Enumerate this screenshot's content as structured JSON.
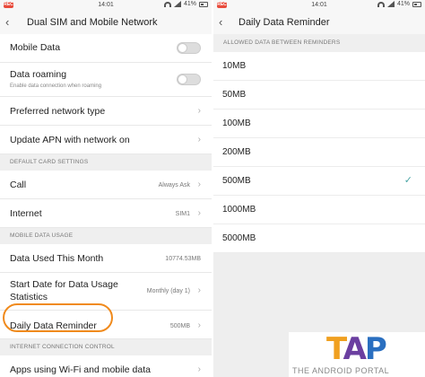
{
  "status": {
    "rec": "REC",
    "time": "14:01",
    "battery": "41%"
  },
  "left": {
    "title": "Dual SIM and Mobile Network",
    "rows": {
      "mobile_data": "Mobile Data",
      "data_roaming": "Data roaming",
      "data_roaming_sub": "Enable data connection when roaming",
      "preferred_network": "Preferred network type",
      "update_apn": "Update APN with network on",
      "call": "Call",
      "call_value": "Always Ask",
      "internet": "Internet",
      "internet_value": "SIM1",
      "data_used": "Data Used This Month",
      "data_used_value": "10774.53MB",
      "start_date_l1": "Start Date for Data Usage",
      "start_date_l2": "Statistics",
      "start_date_value": "Monthly (day 1)",
      "reminder": "Daily Data Reminder",
      "reminder_value": "500MB",
      "apps_wifi": "Apps using Wi-Fi and mobile data"
    },
    "sections": {
      "default_card": "DEFAULT CARD SETTINGS",
      "mobile_usage": "MOBILE DATA USAGE",
      "internet_control": "INTERNET CONNECTION CONTROL"
    }
  },
  "right": {
    "title": "Daily Data Reminder",
    "section": "ALLOWED DATA BETWEEN REMINDERS",
    "options": [
      "10MB",
      "50MB",
      "100MB",
      "200MB",
      "500MB",
      "1000MB",
      "5000MB"
    ],
    "selected": "500MB"
  },
  "watermark": {
    "logo": "TAP",
    "text": "THE ANDROID PORTAL"
  },
  "colors": {
    "highlight": "#f08a1c",
    "check": "#4ba5a5"
  },
  "icons": {
    "back": "back-arrow-icon",
    "chevron": "chevron-right-icon",
    "check": "check-icon"
  }
}
